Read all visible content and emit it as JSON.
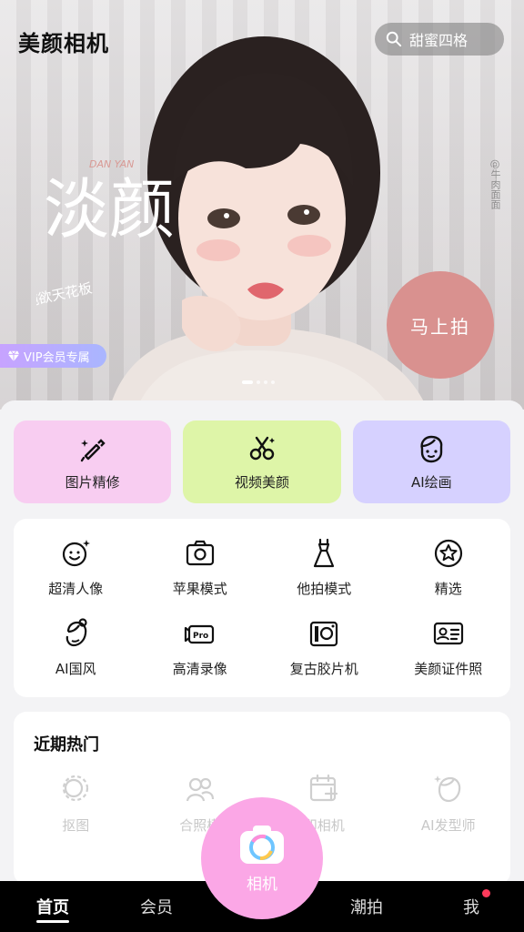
{
  "header": {
    "app_title": "美颜相机",
    "search_text": "甜蜜四格"
  },
  "banner": {
    "headline": "淡颜",
    "romanized": "DAN YAN",
    "subtitle": "纯欲天花板",
    "watermark": "@牛肉面面",
    "shoot_button": "马上拍",
    "vip_badge": "VIP会员专属",
    "dots_total": 4,
    "dots_active": 1
  },
  "big_tools": [
    {
      "label": "图片精修",
      "icon": "makeup-brush-icon"
    },
    {
      "label": "视频美颜",
      "icon": "scissors-icon"
    },
    {
      "label": "AI绘画",
      "icon": "ai-face-icon"
    }
  ],
  "feature_grid": [
    {
      "label": "超清人像",
      "icon": "smile-sparkle-icon"
    },
    {
      "label": "苹果模式",
      "icon": "camera-icon"
    },
    {
      "label": "他拍模式",
      "icon": "dress-icon"
    },
    {
      "label": "精选",
      "icon": "star-badge-icon"
    },
    {
      "label": "AI国风",
      "icon": "hair-bun-icon"
    },
    {
      "label": "高清录像",
      "icon": "video-pro-icon"
    },
    {
      "label": "复古胶片机",
      "icon": "film-camera-icon"
    },
    {
      "label": "美颜证件照",
      "icon": "id-card-icon"
    }
  ],
  "hot": {
    "title": "近期热门",
    "items": [
      {
        "label": "抠图",
        "icon": "cutout-icon"
      },
      {
        "label": "合照模",
        "icon": "group-photo-icon"
      },
      {
        "label": "印相机",
        "icon": "calendar-camera-icon"
      },
      {
        "label": "AI发型师",
        "icon": "hairstyle-icon"
      }
    ]
  },
  "bottom_nav": {
    "items": [
      "首页",
      "会员",
      "潮拍",
      "我"
    ],
    "active": "首页",
    "camera_label": "相机"
  },
  "colors": {
    "shoot_button": "#d9918f",
    "tool_pink": "#f8cdf1",
    "tool_green": "#def5a8",
    "tool_purple": "#d6d1ff",
    "camera_fab": "#fba7e6",
    "notification": "#ff3b5c"
  }
}
